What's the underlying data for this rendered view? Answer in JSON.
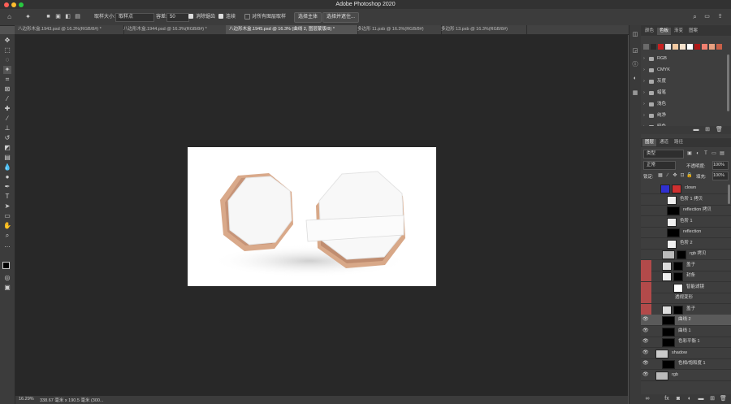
{
  "app": {
    "title": "Adobe Photoshop 2020"
  },
  "options_bar": {
    "sample_size_label": "取样大小:",
    "sample_size_value": "取样点",
    "tolerance_label": "容差:",
    "tolerance_value": "50",
    "anti_alias_label": "消除锯齿",
    "contiguous_label": "连续",
    "all_layers_label": "对所有图层取样",
    "select_subject": "选择主体",
    "select_mask": "选择并遮住..."
  },
  "tabs": [
    {
      "label": "八边形木盒.1943.psd @ 16.3%(RGB/8#) *"
    },
    {
      "label": "八边形木盒.1944.psd @ 16.3%(RGB/8#) *"
    },
    {
      "label": "八边形木盒.1945.psd @ 16.3% (曲线 2, 图层蒙版/8) *"
    },
    {
      "label": "多边形 11.psb @ 16.3%(RGB/8#)"
    },
    {
      "label": "多边形 13.psb @ 16.3%(RGB/8#)"
    }
  ],
  "status": {
    "zoom": "16.29%",
    "doc_size": "338.67 毫米 x 190.5 毫米 (300..."
  },
  "swatches_panel": {
    "tabs": [
      "颜色",
      "色板",
      "渐变",
      "图案"
    ],
    "swatch_colors": [
      "#6a6a6a",
      "#2a2a2a",
      "#c82020",
      "#e8e8e8",
      "#f2c8a0",
      "#f6e2cc",
      "#ffffff",
      "#b01818",
      "#f08070",
      "#e8a080",
      "#c86048"
    ],
    "folders": [
      "RGB",
      "CMYK",
      "灰度",
      "蜡笔",
      "浅色",
      "纯净",
      "暗色"
    ]
  },
  "layers_panel": {
    "tabs": [
      "图层",
      "通道",
      "路径"
    ],
    "kind_filter": "类型",
    "blend_mode": "正常",
    "opacity_label": "不透明度:",
    "opacity_value": "100%",
    "lock_label": "锁定:",
    "fill_label": "填充:",
    "fill_value": "100%",
    "layers": [
      {
        "name": "clown",
        "visible": false,
        "selected": false,
        "marked": false
      },
      {
        "name": "色阶 1 拷贝",
        "visible": false,
        "selected": false,
        "marked": false
      },
      {
        "name": "reflection 拷贝",
        "visible": false,
        "selected": false,
        "marked": false
      },
      {
        "name": "色阶 1",
        "visible": false,
        "selected": false,
        "marked": false
      },
      {
        "name": "reflection",
        "visible": false,
        "selected": false,
        "marked": false
      },
      {
        "name": "色阶 2",
        "visible": false,
        "selected": false,
        "marked": false
      },
      {
        "name": "rgb 拷贝",
        "visible": false,
        "selected": false,
        "marked": false
      },
      {
        "name": "盖子",
        "visible": false,
        "selected": false,
        "marked": true
      },
      {
        "name": "封条",
        "visible": false,
        "selected": false,
        "marked": true
      },
      {
        "name": "智能滤镜",
        "visible": false,
        "selected": false,
        "marked": true
      },
      {
        "name": "透视变形",
        "visible": false,
        "selected": false,
        "marked": true
      },
      {
        "name": "盖子",
        "visible": false,
        "selected": false,
        "marked": true
      },
      {
        "name": "曲线 2",
        "visible": true,
        "selected": true,
        "marked": false
      },
      {
        "name": "曲线 1",
        "visible": true,
        "selected": false,
        "marked": false
      },
      {
        "name": "色彩平衡 1",
        "visible": true,
        "selected": false,
        "marked": false
      },
      {
        "name": "shadow",
        "visible": true,
        "selected": false,
        "marked": false
      },
      {
        "name": "色相/饱和度 1",
        "visible": true,
        "selected": false,
        "marked": false
      },
      {
        "name": "rgb",
        "visible": true,
        "selected": false,
        "marked": false
      }
    ]
  }
}
